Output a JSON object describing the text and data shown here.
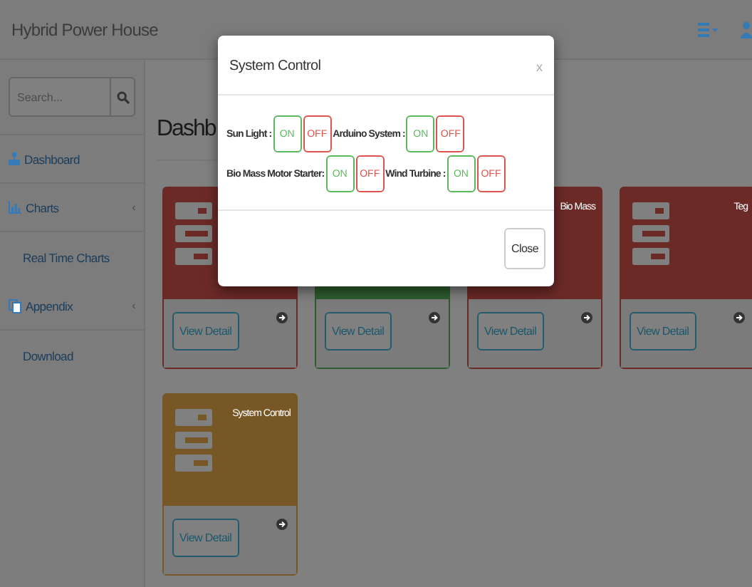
{
  "navbar": {
    "brand": "Hybrid Power House"
  },
  "sidebar": {
    "search": {
      "placeholder": "Search..."
    },
    "items": [
      {
        "label": "Dashboard"
      },
      {
        "label": "Charts",
        "chevron": "‹",
        "children": [
          {
            "label": "Real Time Charts"
          }
        ]
      },
      {
        "label": "Appendix",
        "chevron": "‹",
        "children": [
          {
            "label": "Download"
          }
        ]
      }
    ]
  },
  "page": {
    "heading": "Dashb"
  },
  "cards": [
    {
      "color": "#6c2a27",
      "button": "View Detail"
    },
    {
      "color": "#2e5c2e",
      "button": "View Detail"
    },
    {
      "color": "#6c2a27",
      "title": "Bio Mass",
      "button": "View Detail"
    },
    {
      "color": "#6c2a27",
      "title": "Teg",
      "button": "View Detail"
    },
    {
      "color": "#785727",
      "title": "System Control",
      "button": "View Detail"
    }
  ],
  "modal": {
    "title": "System Control",
    "close": "x",
    "rows": [
      [
        {
          "label": "Sun Light :",
          "on": "ON",
          "off": "OFF"
        },
        {
          "label": "Arduino System :",
          "on": "ON",
          "off": "OFF"
        }
      ],
      [
        {
          "label": "Bio Mass Motor Starter:",
          "on": "ON",
          "off": "OFF"
        },
        {
          "label": "Wind Turbine :",
          "on": "ON",
          "off": "OFF"
        }
      ]
    ],
    "footer_button": "Close"
  }
}
